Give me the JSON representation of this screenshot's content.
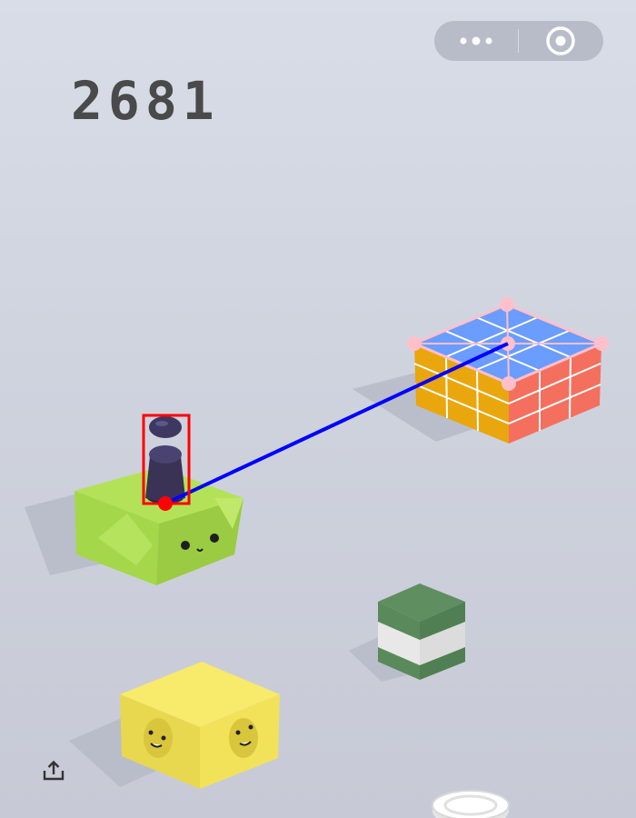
{
  "score": "2681",
  "capsule": {
    "more_icon": "more-dots-icon",
    "close_icon": "target-circle-icon"
  },
  "share_icon": "share-upload-icon",
  "colors": {
    "background": "#d3d6e0",
    "score_text": "#4a4a4a",
    "capsule_bg": "#b8bcc8",
    "trajectory_line": "#0000ff",
    "player_bbox": "#ff0000",
    "target_outline": "#ffc0cb",
    "green_block": "#a4d84a",
    "yellow_block": "#f2e25a",
    "player": "#3a3356"
  },
  "overlays": {
    "player_bbox_color": "#ff0000",
    "trajectory_color": "#0000ff",
    "target_outline_color": "#ffc0cb"
  }
}
